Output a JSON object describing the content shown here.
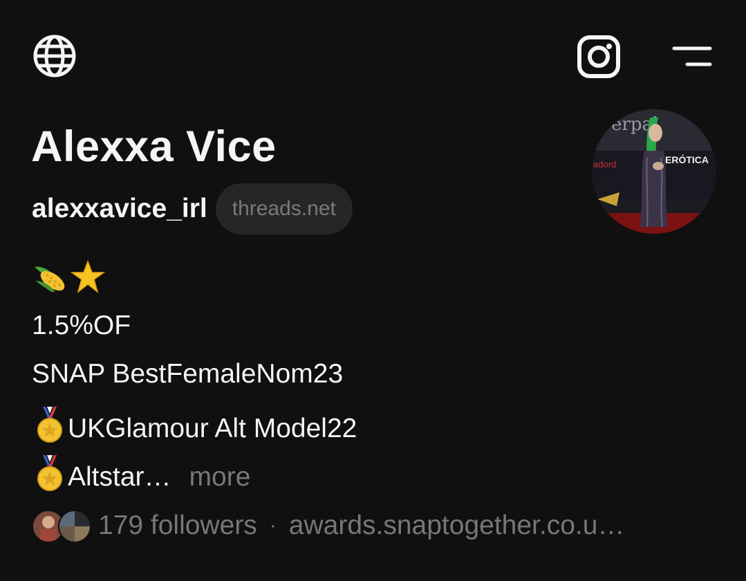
{
  "header": {
    "globe_icon": "globe-icon",
    "instagram_icon": "instagram-icon",
    "menu_icon": "menu-icon"
  },
  "profile": {
    "name": "Alexxa Vice",
    "username": "alexxavice_irl",
    "domain_badge": "threads.net",
    "avatar": "profile-avatar"
  },
  "bio": {
    "line2": "1.5%OF",
    "line3": "SNAP BestFemaleNom23",
    "line4": "UKGlamour Alt Model22",
    "line5": "Altstar",
    "ellipsis": "…",
    "more_label": "more"
  },
  "footer": {
    "followers": "179 followers",
    "separator": "·",
    "link": "awards.snaptogether.co.u…"
  },
  "colors": {
    "background": "#101010",
    "text_primary": "#f3f5f7",
    "text_secondary": "#777777",
    "badge_bg": "#262626"
  }
}
